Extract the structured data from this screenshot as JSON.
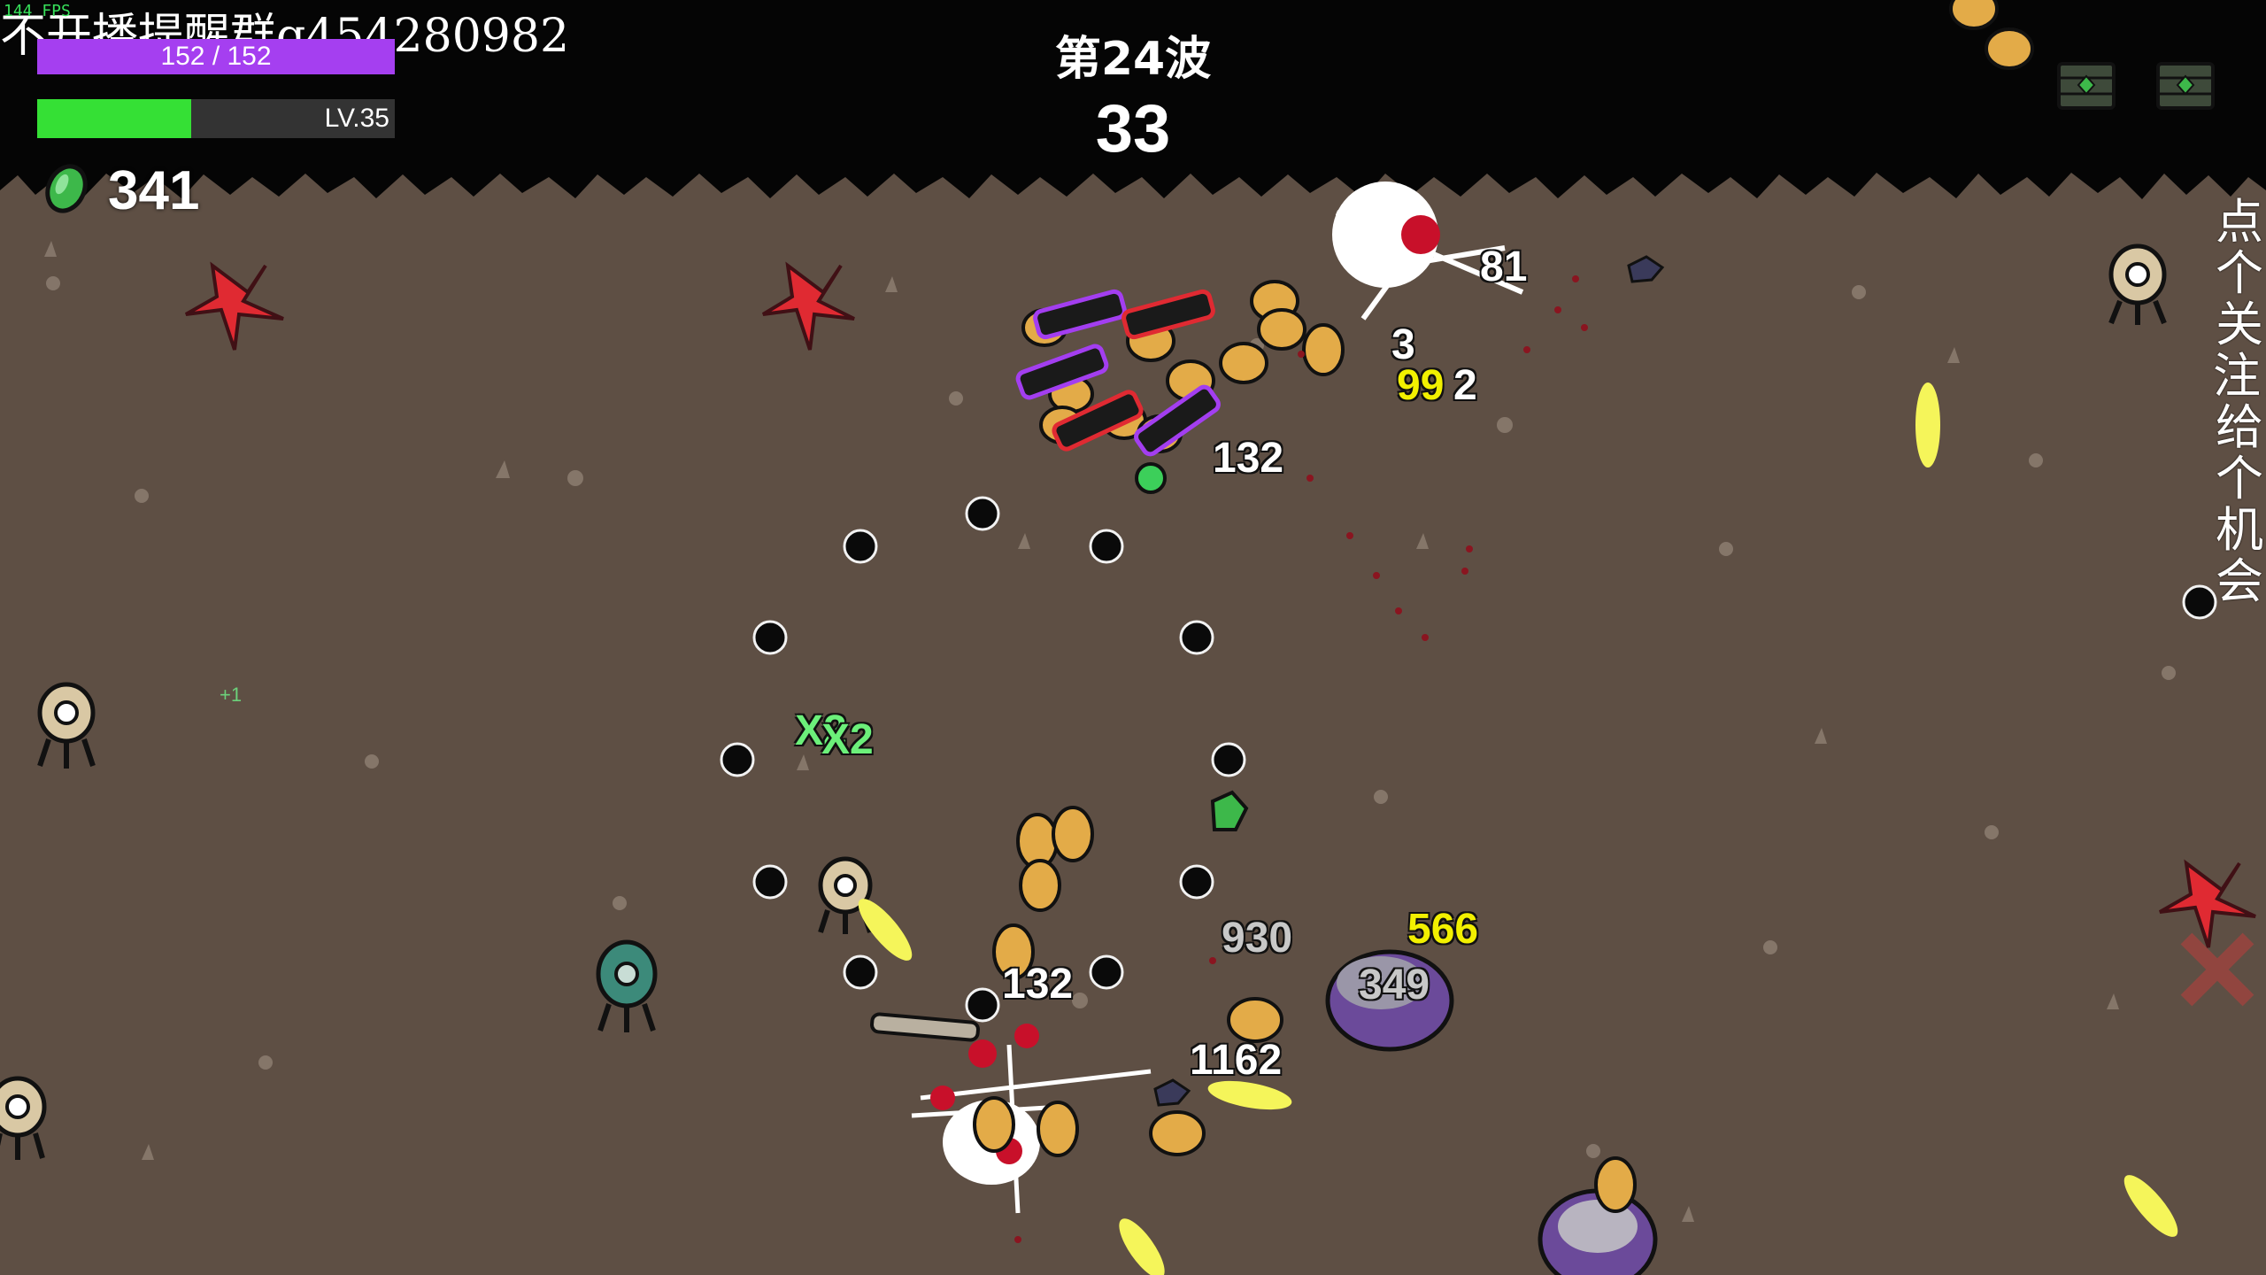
{
  "overlay": {
    "fps": "144 FPS",
    "title": "不开播提醒群q454280982",
    "side_text": "点个关注，给个机会"
  },
  "hud": {
    "hp_text": "152 / 152",
    "hp_fraction": 1.0,
    "level_text": "LV.35",
    "xp_fraction": 0.43,
    "materials_count": "341",
    "wave_title": "第24波",
    "timer": "33"
  },
  "colors": {
    "hp": "#a53ff0",
    "xp": "#35e035",
    "ground": "#5e4f44",
    "material": "#3db84a"
  },
  "floating_numbers": {
    "n1": "81",
    "n2": "3",
    "n3": "99",
    "n4": "2",
    "n5": "132",
    "n6": "930",
    "n7": "566",
    "n8": "349",
    "n9": "132",
    "n10": "1162",
    "pickup": "+1",
    "mult": "X2",
    "mult2": "X2"
  }
}
